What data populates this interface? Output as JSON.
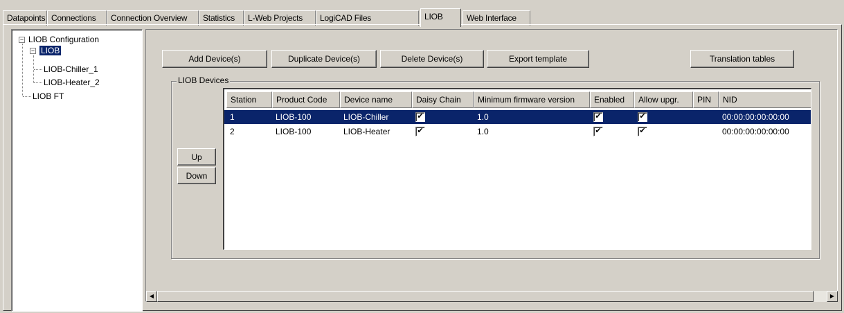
{
  "tabs": [
    {
      "label": "Datapoints"
    },
    {
      "label": "Connections"
    },
    {
      "label": "Connection Overview"
    },
    {
      "label": "Statistics"
    },
    {
      "label": "L-Web Projects"
    },
    {
      "label": "LogiCAD Files"
    },
    {
      "label": "LIOB"
    },
    {
      "label": "Web Interface"
    }
  ],
  "active_tab": "LIOB",
  "tree": {
    "root": {
      "label": "LIOB Configuration",
      "expander": "−"
    },
    "liob": {
      "label": "LIOB",
      "expander": "−"
    },
    "children": [
      {
        "label": "LIOB-Chiller_1"
      },
      {
        "label": "LIOB-Heater_2"
      }
    ],
    "liob_ft": {
      "label": "LIOB FT"
    }
  },
  "toolbar": {
    "add": "Add Device(s)",
    "duplicate": "Duplicate Device(s)",
    "delete": "Delete Device(s)",
    "export": "Export template",
    "translation": "Translation tables"
  },
  "group": {
    "title": "LIOB Devices"
  },
  "reorder": {
    "up": "Up",
    "down": "Down"
  },
  "table": {
    "columns": [
      "Station",
      "Product Code",
      "Device name",
      "Daisy Chain",
      "Minimum firmware version",
      "Enabled",
      "Allow upgr.",
      "PIN",
      "NID"
    ],
    "rows": [
      {
        "station": "1",
        "product_code": "LIOB-100",
        "device_name": "LIOB-Chiller",
        "daisy_chain": true,
        "min_fw": "1.0",
        "enabled": true,
        "allow_upgr": true,
        "pin": "",
        "nid": "00:00:00:00:00:00",
        "selected": true
      },
      {
        "station": "2",
        "product_code": "LIOB-100",
        "device_name": "LIOB-Heater",
        "daisy_chain": true,
        "min_fw": "1.0",
        "enabled": true,
        "allow_upgr": true,
        "pin": "",
        "nid": "00:00:00:00:00:00",
        "selected": false
      }
    ]
  },
  "scrollbar": {
    "left_arrow": "◀",
    "right_arrow": "▶"
  },
  "icons": {
    "check": "✔"
  },
  "colors": {
    "selection": "#0a246a",
    "face": "#d4d0c8"
  }
}
